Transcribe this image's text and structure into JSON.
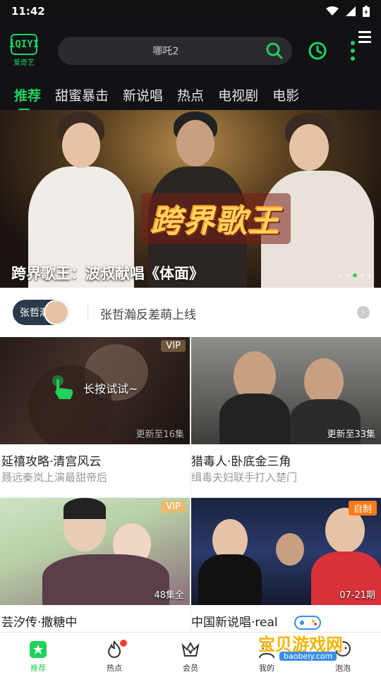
{
  "status_bar": {
    "time": "11:42"
  },
  "app": {
    "logo_text": "iQIYI",
    "logo_sub": "爱奇艺"
  },
  "search": {
    "placeholder": "哪吒2"
  },
  "tabs": [
    {
      "label": "推荐",
      "active": true
    },
    {
      "label": "甜蜜暴击"
    },
    {
      "label": "新说唱"
    },
    {
      "label": "热点"
    },
    {
      "label": "电视剧"
    },
    {
      "label": "电影"
    }
  ],
  "banner": {
    "logo_text": "跨界歌王",
    "caption": "跨界歌王：波叔献唱《体面》"
  },
  "notice": {
    "badge_text": "张哲瀚",
    "text": "张哲瀚反差萌上线"
  },
  "cards": [
    {
      "title": "延禧攻略·清宫风云",
      "subtitle": "聂远秦岚上演最甜帝后",
      "badge": "VIP",
      "episodes": "更新至16集",
      "hint": "长按试试~"
    },
    {
      "title": "猎毒人·卧底金三角",
      "subtitle": "缉毒夫妇联手打入楚门",
      "badge": "",
      "episodes": "更新至33集"
    },
    {
      "title": "芸汐传·撒糖中",
      "subtitle": "",
      "badge": "VIP",
      "episodes": "48集全"
    },
    {
      "title": "中国新说唱·real",
      "subtitle": "",
      "badge": "自制",
      "episodes": "07-21期"
    }
  ],
  "bottom_nav": [
    {
      "label": "推荐",
      "icon": "home-icon",
      "active": true
    },
    {
      "label": "热点",
      "icon": "flame-icon",
      "dot": true
    },
    {
      "label": "会员",
      "icon": "crown-icon"
    },
    {
      "label": "我的",
      "icon": "person-icon"
    },
    {
      "label": "泡泡",
      "icon": "bubble-icon"
    }
  ],
  "watermark": {
    "title": "宝贝游戏网",
    "url": "baobeiy.com"
  },
  "colors": {
    "accent": "#1fd15b",
    "header_bg": "#121216",
    "vip": "#e8b970",
    "self_badge": "#ff7a1a"
  }
}
